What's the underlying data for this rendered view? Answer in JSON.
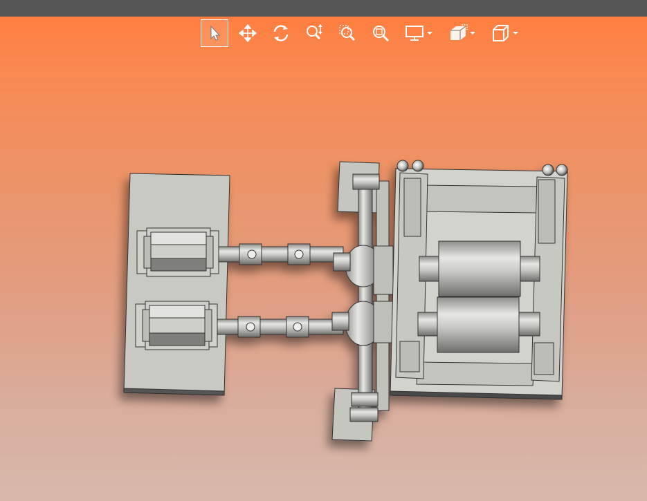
{
  "window": {
    "topbar_color": "#555555"
  },
  "viewport": {
    "background_top": "#ff7e3f",
    "background_bottom": "#d7b9ab"
  },
  "toolbar": {
    "tools": [
      {
        "id": "select",
        "icon": "cursor-arrow-icon",
        "active": true
      },
      {
        "id": "pan",
        "icon": "move-arrows-icon",
        "active": false
      },
      {
        "id": "rotate",
        "icon": "rotate-icon",
        "active": false
      },
      {
        "id": "zoom",
        "icon": "zoom-updown-icon",
        "active": false
      },
      {
        "id": "zoom-window",
        "icon": "zoom-window-icon",
        "active": false
      },
      {
        "id": "zoom-fit",
        "icon": "zoom-fit-icon",
        "active": false
      },
      {
        "id": "display",
        "icon": "monitor-icon",
        "dropdown": true
      },
      {
        "id": "section",
        "icon": "section-cube-icon",
        "dropdown": true
      },
      {
        "id": "view",
        "icon": "view-cube-icon",
        "dropdown": true
      }
    ]
  },
  "model": {
    "description_icon": "cad-assembly-icon",
    "base_color": "#cfcfca",
    "shadow_color": "#3a3a3a"
  }
}
